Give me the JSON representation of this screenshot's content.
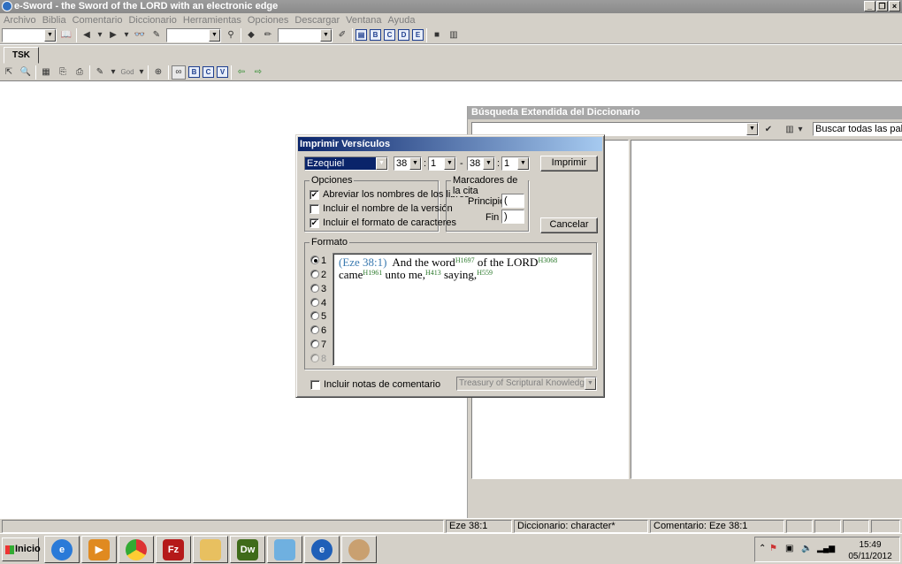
{
  "window": {
    "title": "e-Sword - the Sword of the LORD with an electronic edge"
  },
  "menu": [
    "Archivo",
    "Biblia",
    "Comentario",
    "Diccionario",
    "Herramientas",
    "Opciones",
    "Descargar",
    "Ventana",
    "Ayuda"
  ],
  "toolbar2": {
    "god_label": "God"
  },
  "tab": {
    "label": "TSK"
  },
  "dictionary": {
    "title": "Búsqueda Extendida del Diccionario",
    "search_mode": "Buscar todas las palabras"
  },
  "dialog": {
    "title": "Imprimir Versículos",
    "book": "Ezequiel",
    "from_chapter": "38",
    "from_verse": "1",
    "separator": "-",
    "to_chapter": "38",
    "to_verse": "1",
    "print_button": "Imprimir",
    "cancel_button": "Cancelar",
    "options": {
      "label": "Opciones",
      "items": [
        {
          "label": "Abreviar los nombres de los libros",
          "checked": true
        },
        {
          "label": "Incluir el nombre de la versión",
          "checked": false
        },
        {
          "label": "Incluir el formato de caracteres",
          "checked": true
        }
      ]
    },
    "markers": {
      "label": "Marcadores de la cita",
      "start_label": "Principio",
      "start_value": "(",
      "end_label": "Fin",
      "end_value": ")"
    },
    "format": {
      "label": "Formato",
      "options": [
        "1",
        "2",
        "3",
        "4",
        "5",
        "6",
        "7",
        "8"
      ],
      "selected": "1"
    },
    "preview": {
      "ref": "(Eze 38:1)",
      "w1": "And the word",
      "s1": "H1697",
      "w2": "of the LORD",
      "s2": "H3068",
      "w3": "came",
      "s3": "H1961",
      "w4": "unto me,",
      "s4": "H413",
      "w5": "saying,",
      "s5": "H559"
    },
    "commentary_notes": {
      "label": "Incluir notas de comentario",
      "checked": false,
      "source": "Treasury of Scriptural Knowledge"
    }
  },
  "status": {
    "verse": "Eze 38:1",
    "dictionary": "Diccionario: character*",
    "commentary": "Comentario: Eze 38:1"
  },
  "taskbar": {
    "start": "Inicio",
    "time": "15:49",
    "date": "05/11/2012"
  }
}
